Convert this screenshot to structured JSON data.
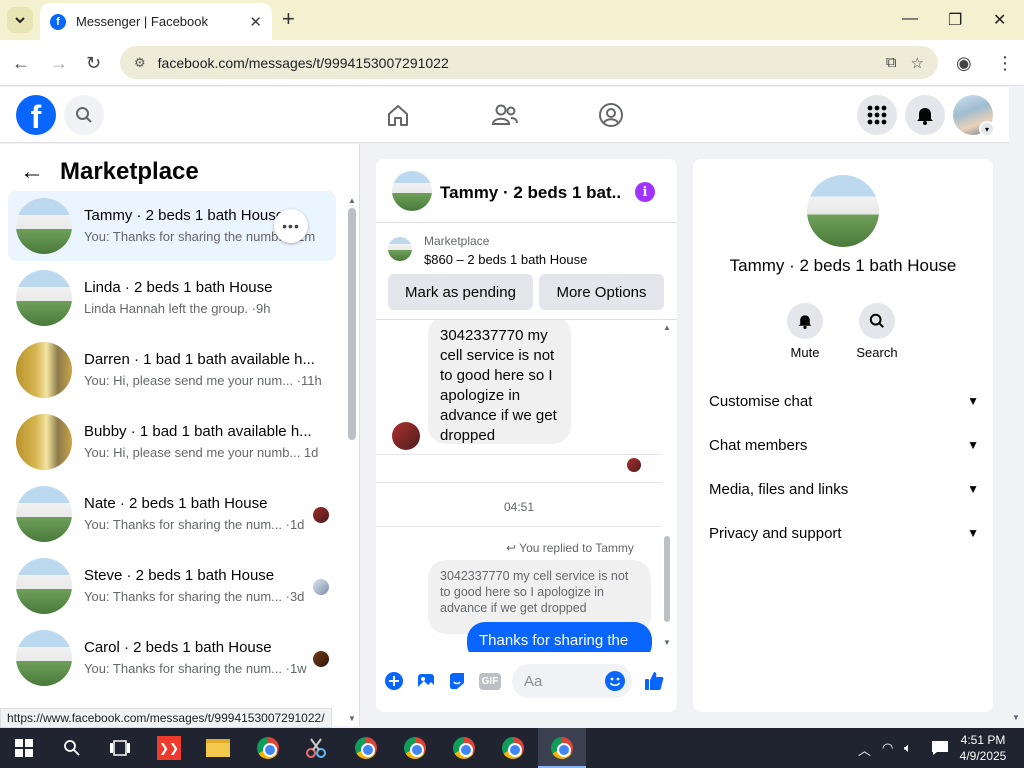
{
  "browser": {
    "tab_title": "Messenger | Facebook",
    "tab_favicon": "f",
    "new_tab": "+",
    "url": "facebook.com/messages/t/9994153007291022",
    "status_url": "https://www.facebook.com/messages/t/9994153007291022/"
  },
  "fb": {
    "logo": "f"
  },
  "left": {
    "title": "Marketplace",
    "conversations": [
      {
        "name": "Tammy · 2 beds 1 bath House",
        "preview": "You: Thanks for sharing the numb... ·1m"
      },
      {
        "name": "Linda · 2 beds 1 bath House",
        "preview": "Linda Hannah left the group. ·9h"
      },
      {
        "name": "Darren · 1 bad 1 bath available h...",
        "preview": "You: Hi, please send me your num... ·11h"
      },
      {
        "name": "Bubby · 1 bad 1 bath available h...",
        "preview": "You: Hi, please send me your numb...  1d"
      },
      {
        "name": "Nate · 2 beds 1 bath House",
        "preview": "You: Thanks for sharing the num... ·1d"
      },
      {
        "name": "Steve · 2 beds 1 bath House",
        "preview": "You: Thanks for sharing the num... ·3d"
      },
      {
        "name": "Carol · 2 beds 1 bath House",
        "preview": "You: Thanks for sharing the num... ·1w"
      }
    ],
    "more_dots": "•••"
  },
  "chat": {
    "header_name": "Tammy · 2 beds 1 bat...",
    "info_glyph": "i",
    "marketplace_label": "Marketplace",
    "listing": "$860 – 2 beds 1 bath House",
    "mark_pending": "Mark as pending",
    "more_options": "More Options",
    "incoming_message": "3042337770 my cell service is not to good here so I apologize in advance if we get dropped",
    "timestamp": "04:51",
    "replied_label": "You replied to Tammy",
    "quoted_message": "3042337770 my cell service is not to good here so I apologize in advance if we get dropped",
    "outgoing_message": "Thanks for sharing the",
    "composer_placeholder": "Aa",
    "gif_label": "GIF"
  },
  "info": {
    "name": "Tammy · 2 beds 1 bath House",
    "mute": "Mute",
    "search": "Search",
    "sections": [
      "Customise chat",
      "Chat members",
      "Media, files and links",
      "Privacy and support"
    ]
  },
  "taskbar": {
    "time": "4:51 PM",
    "date": "4/9/2025"
  },
  "colors": {
    "fb_blue": "#0866ff",
    "active_conv": "#ebf5ff",
    "info_purple": "#a033ff",
    "tabbar": "#f4f1d0"
  }
}
